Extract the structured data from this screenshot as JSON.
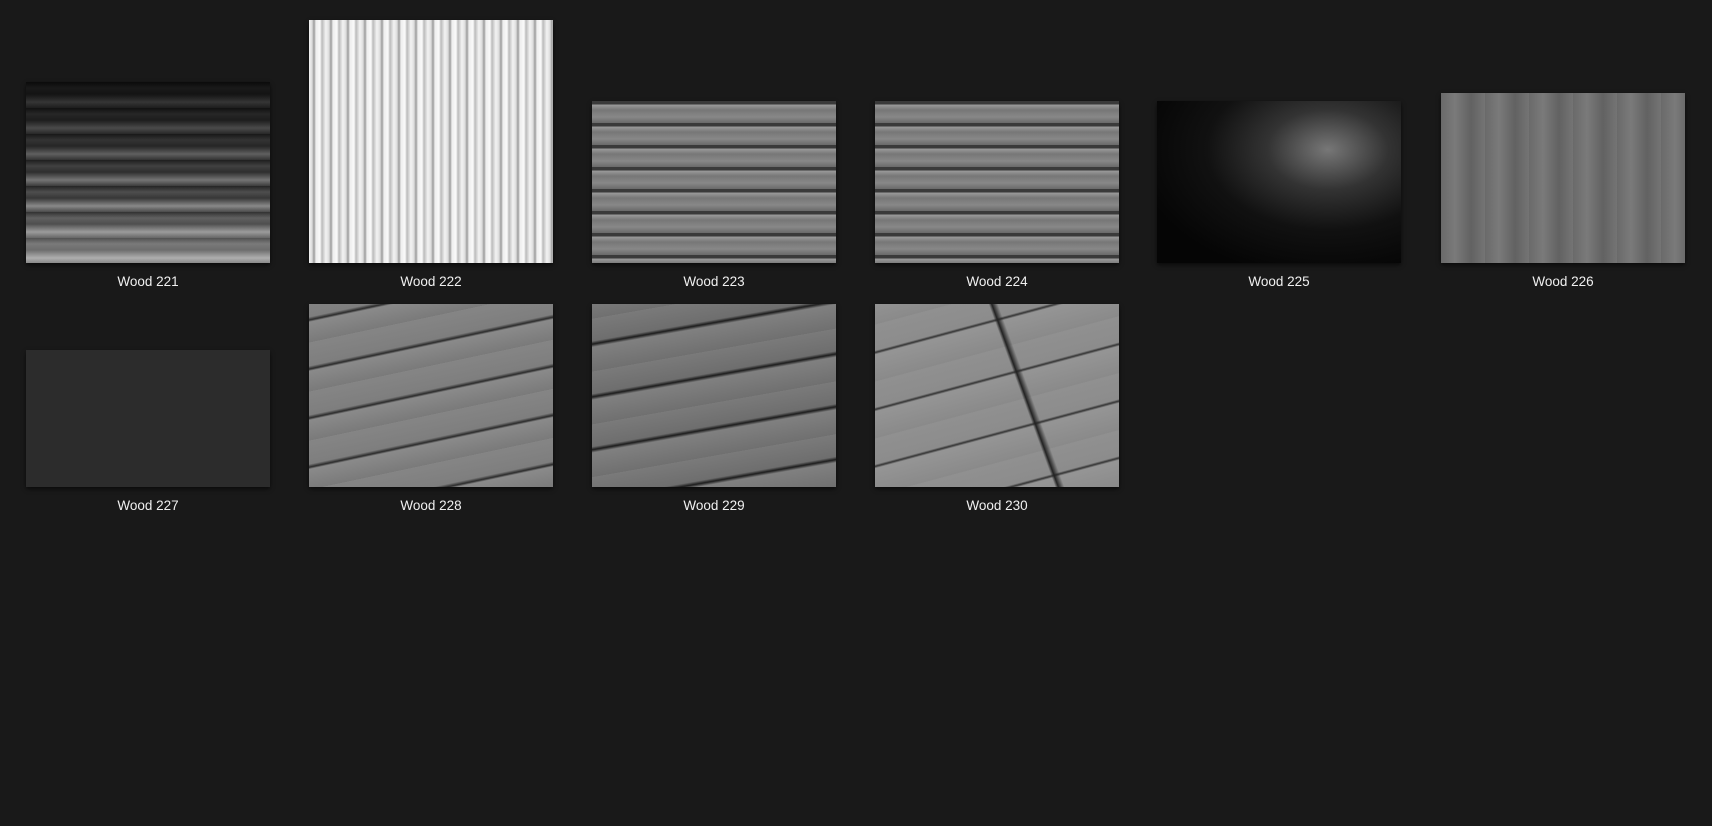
{
  "items": [
    {
      "name": "Wood 221"
    },
    {
      "name": "Wood 222"
    },
    {
      "name": "Wood 223"
    },
    {
      "name": "Wood 224"
    },
    {
      "name": "Wood 225"
    },
    {
      "name": "Wood 226"
    },
    {
      "name": "Wood 227"
    },
    {
      "name": "Wood 228"
    },
    {
      "name": "Wood 229"
    },
    {
      "name": "Wood 230"
    }
  ]
}
